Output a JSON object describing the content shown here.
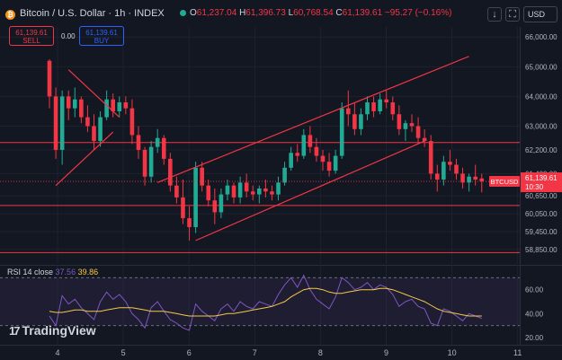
{
  "header": {
    "coin_glyph": "₿",
    "title": "Bitcoin / U.S. Dollar · 1h · INDEX",
    "o_label": "O",
    "o_value": "61,237.04",
    "h_label": "H",
    "h_value": "61,396.73",
    "l_label": "L",
    "l_value": "60,768.54",
    "c_label": "C",
    "c_value": "61,139.61",
    "change": "−95.27 (−0.16%)",
    "download_icon": "download-icon",
    "fullscreen_icon": "fullscreen-icon",
    "currency": "USD"
  },
  "trade": {
    "sell_price": "61,139.61",
    "sell_label": "SELL",
    "spread": "0.00",
    "buy_price": "61,139.61",
    "buy_label": "BUY"
  },
  "rsi": {
    "label": "RSI 14 close",
    "value1": "37.56",
    "value2": "39.86"
  },
  "brand": {
    "logo_mark": "17",
    "name": "TradingView"
  },
  "colors": {
    "up": "#22ab94",
    "down": "#f23645",
    "rsi": "#7e57c2",
    "rsi_ma": "#f7c948",
    "level": "#f23645",
    "background": "#131722"
  },
  "chart_data": {
    "type": "candlestick",
    "symbol": "BTCUSD",
    "interval": "1h",
    "y_ticks": [
      58850,
      59450,
      60050,
      60650,
      61400,
      62200,
      63000,
      64000,
      65000,
      66000
    ],
    "y_tick_labels": [
      "58,850.00",
      "59,450.00",
      "60,050.00",
      "60,650.00",
      "61,400.00",
      "62,200.00",
      "63,000.00",
      "64,000.00",
      "65,000.00",
      "66,000.00"
    ],
    "x_ticks": [
      "4",
      "5",
      "6",
      "7",
      "8",
      "9",
      "10",
      "11"
    ],
    "last_price_label": "BTCUSD",
    "last_price": "61,139.61",
    "countdown": "10:30",
    "horizontal_levels": [
      62450,
      60330,
      58740
    ],
    "candles": [
      [
        65200,
        65250,
        63600,
        64000
      ],
      [
        64000,
        64300,
        61900,
        62200
      ],
      [
        62200,
        64200,
        61700,
        64000
      ],
      [
        64000,
        64200,
        63200,
        63600
      ],
      [
        63600,
        64300,
        63300,
        63900
      ],
      [
        63900,
        64000,
        63100,
        63300
      ],
      [
        63300,
        63700,
        62800,
        63000
      ],
      [
        63000,
        63400,
        62200,
        62500
      ],
      [
        62500,
        63500,
        62300,
        63300
      ],
      [
        63300,
        64200,
        63200,
        63900
      ],
      [
        63900,
        64100,
        63300,
        63500
      ],
      [
        63500,
        64000,
        63300,
        63800
      ],
      [
        63800,
        64000,
        63400,
        63600
      ],
      [
        63600,
        63900,
        62400,
        62700
      ],
      [
        62700,
        63000,
        61900,
        62200
      ],
      [
        62200,
        62300,
        61000,
        61300
      ],
      [
        61300,
        62500,
        61100,
        62300
      ],
      [
        62300,
        62900,
        62100,
        62600
      ],
      [
        62600,
        62700,
        61700,
        61900
      ],
      [
        61900,
        62100,
        60800,
        61000
      ],
      [
        61000,
        61300,
        60400,
        60600
      ],
      [
        60600,
        61200,
        59700,
        59900
      ],
      [
        59900,
        60300,
        59150,
        59600
      ],
      [
        59600,
        61800,
        59400,
        61600
      ],
      [
        61600,
        61800,
        60800,
        61000
      ],
      [
        61000,
        61200,
        60300,
        60500
      ],
      [
        60500,
        60900,
        59700,
        60100
      ],
      [
        60100,
        60900,
        59900,
        60700
      ],
      [
        60700,
        61200,
        60500,
        61000
      ],
      [
        61000,
        61100,
        60400,
        60600
      ],
      [
        60600,
        61300,
        60400,
        61100
      ],
      [
        61100,
        61400,
        60600,
        60800
      ],
      [
        60800,
        61000,
        60500,
        60700
      ],
      [
        60700,
        61000,
        60400,
        60900
      ],
      [
        60900,
        61200,
        60600,
        60800
      ],
      [
        60800,
        61000,
        60500,
        60700
      ],
      [
        60700,
        61300,
        60500,
        61100
      ],
      [
        61100,
        61800,
        61000,
        61600
      ],
      [
        61600,
        62300,
        61500,
        62100
      ],
      [
        62100,
        62400,
        61800,
        62000
      ],
      [
        62000,
        62900,
        61900,
        62700
      ],
      [
        62700,
        63000,
        62100,
        62300
      ],
      [
        62300,
        62600,
        61800,
        62000
      ],
      [
        62000,
        62200,
        61500,
        61800
      ],
      [
        61800,
        62100,
        61300,
        61500
      ],
      [
        61500,
        62200,
        61400,
        62000
      ],
      [
        62000,
        63800,
        61900,
        63600
      ],
      [
        63600,
        64200,
        63000,
        63400
      ],
      [
        63400,
        63800,
        62700,
        62900
      ],
      [
        62900,
        63600,
        62700,
        63400
      ],
      [
        63400,
        64000,
        63200,
        63800
      ],
      [
        63800,
        64000,
        63300,
        63500
      ],
      [
        63500,
        64100,
        63400,
        63900
      ],
      [
        63900,
        64200,
        63600,
        63800
      ],
      [
        63800,
        64000,
        63200,
        63400
      ],
      [
        63400,
        63700,
        62700,
        62900
      ],
      [
        62900,
        63200,
        62500,
        63100
      ],
      [
        63100,
        63400,
        62800,
        63000
      ],
      [
        63000,
        63300,
        62400,
        62600
      ],
      [
        62600,
        62900,
        62300,
        62500
      ],
      [
        62500,
        62700,
        61200,
        61400
      ],
      [
        61400,
        61700,
        60800,
        61200
      ],
      [
        61200,
        62000,
        61000,
        61800
      ],
      [
        61800,
        62200,
        61500,
        61700
      ],
      [
        61700,
        61900,
        61200,
        61400
      ],
      [
        61400,
        61600,
        60900,
        61100
      ],
      [
        61100,
        61400,
        60800,
        61300
      ],
      [
        61300,
        61700,
        61000,
        61200
      ],
      [
        61237.04,
        61396.73,
        60768.54,
        61139.61
      ]
    ],
    "rsi": {
      "label": "RSI 14 close",
      "levels": [
        70,
        30
      ],
      "y_ticks": [
        20,
        40,
        60
      ],
      "y_tick_labels": [
        "20.00",
        "40.00",
        "60.00"
      ],
      "ylim": [
        14,
        80
      ],
      "rsi_values": [
        38,
        30,
        55,
        48,
        52,
        45,
        40,
        35,
        50,
        58,
        52,
        56,
        50,
        40,
        35,
        28,
        45,
        50,
        42,
        35,
        32,
        28,
        26,
        48,
        42,
        38,
        34,
        44,
        48,
        42,
        50,
        46,
        44,
        50,
        48,
        46,
        56,
        64,
        70,
        62,
        72,
        60,
        52,
        48,
        44,
        54,
        70,
        66,
        60,
        62,
        66,
        60,
        64,
        62,
        56,
        46,
        50,
        52,
        46,
        44,
        32,
        30,
        44,
        42,
        38,
        34,
        40,
        38,
        36
      ],
      "ma_values": [
        42,
        41,
        41,
        42,
        43,
        43,
        42,
        42,
        42,
        43,
        44,
        45,
        45,
        45,
        44,
        43,
        42,
        42,
        42,
        41,
        40,
        39,
        38,
        38,
        38,
        38,
        38,
        39,
        40,
        40,
        41,
        42,
        43,
        44,
        45,
        46,
        48,
        50,
        54,
        57,
        60,
        61,
        61,
        60,
        58,
        57,
        57,
        58,
        59,
        60,
        60,
        60,
        61,
        61,
        60,
        58,
        56,
        54,
        52,
        50,
        47,
        44,
        42,
        41,
        40,
        39,
        38,
        38,
        38
      ]
    },
    "trendlines": [
      {
        "from": [
          3,
          64900
        ],
        "to": [
          11,
          63300
        ]
      },
      {
        "from": [
          1,
          61000
        ],
        "to": [
          10,
          62800
        ]
      },
      {
        "from": [
          17,
          61100
        ],
        "to": [
          66,
          65350
        ]
      },
      {
        "from": [
          23,
          59150
        ],
        "to": [
          59,
          62500
        ]
      }
    ]
  }
}
